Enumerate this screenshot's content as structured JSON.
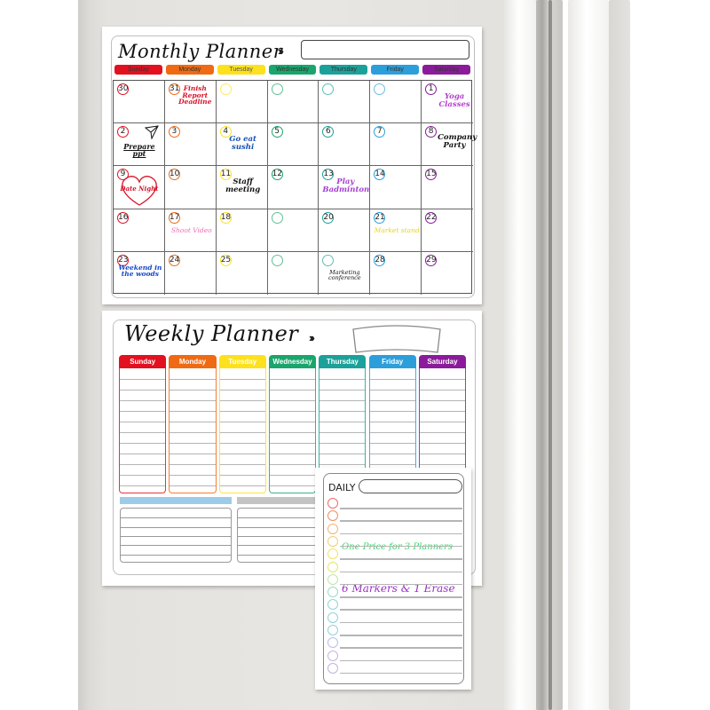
{
  "colors": {
    "sunday": "#e3101f",
    "monday": "#ef6a13",
    "tuesday": "#fde11d",
    "wednesday": "#1aa56c",
    "thursday": "#1ba19a",
    "friday": "#2c9fdb",
    "saturday": "#8b1b9a"
  },
  "monthly": {
    "title": "Monthly Planner",
    "arrows": "›››",
    "days": [
      "Sunday",
      "Monday",
      "Tuesday",
      "Wednesday",
      "Thursday",
      "Friday",
      "Saturday"
    ],
    "weeks": [
      [
        {
          "num": "30",
          "note": ""
        },
        {
          "num": "31",
          "note": "Finish Report Deadline"
        },
        {
          "num": "",
          "note": ""
        },
        {
          "num": "",
          "note": ""
        },
        {
          "num": "",
          "note": ""
        },
        {
          "num": "",
          "note": ""
        },
        {
          "num": "1",
          "note": "Yoga Classes"
        }
      ],
      [
        {
          "num": "2",
          "note": "Prepare ppt"
        },
        {
          "num": "3",
          "note": ""
        },
        {
          "num": "4",
          "note": "Go eat sushi"
        },
        {
          "num": "5",
          "note": ""
        },
        {
          "num": "6",
          "note": ""
        },
        {
          "num": "7",
          "note": ""
        },
        {
          "num": "8",
          "note": "Company Party"
        }
      ],
      [
        {
          "num": "9",
          "note": "Date Night"
        },
        {
          "num": "10",
          "note": ""
        },
        {
          "num": "11",
          "note": "Staff meeting"
        },
        {
          "num": "12",
          "note": ""
        },
        {
          "num": "13",
          "note": "Play Badminton"
        },
        {
          "num": "14",
          "note": ""
        },
        {
          "num": "15",
          "note": ""
        }
      ],
      [
        {
          "num": "16",
          "note": ""
        },
        {
          "num": "17",
          "note": "Shoot Video"
        },
        {
          "num": "18",
          "note": ""
        },
        {
          "num": "",
          "note": ""
        },
        {
          "num": "20",
          "note": ""
        },
        {
          "num": "21",
          "note": "Market stand"
        },
        {
          "num": "22",
          "note": ""
        }
      ],
      [
        {
          "num": "23",
          "note": "Weekend in the woods"
        },
        {
          "num": "24",
          "note": ""
        },
        {
          "num": "25",
          "note": ""
        },
        {
          "num": "",
          "note": ""
        },
        {
          "num": "",
          "note": "Marketing conference"
        },
        {
          "num": "28",
          "note": ""
        },
        {
          "num": "29",
          "note": ""
        }
      ]
    ],
    "note_colors": {
      "Finish Report Deadline": "#d8142a",
      "Yoga Classes": "#b43fcf",
      "Prepare ppt": "#111111",
      "Go eat sushi": "#1550b5",
      "Company Party": "#111111",
      "Date Night": "#d8142a",
      "Staff meeting": "#111111",
      "Play Badminton": "#a53fd0",
      "Shoot Video": "#ee6fb7",
      "Market stand": "#e9d21c",
      "Weekend in the woods": "#1248c8",
      "Marketing conference": "#111111"
    }
  },
  "weekly": {
    "title": "Weekly Planner",
    "arrows": "›››",
    "days": [
      "Sunday",
      "Monday",
      "Tuesday",
      "Wednesday",
      "Thursday",
      "Friday",
      "Saturday"
    ]
  },
  "daily": {
    "title": "DAILY",
    "notes": [
      {
        "text": "One Price for 3 Planners",
        "color": "#39d96a"
      },
      {
        "text": "6 Markers & 1 Erase",
        "color": "#9b2fc4"
      }
    ]
  }
}
